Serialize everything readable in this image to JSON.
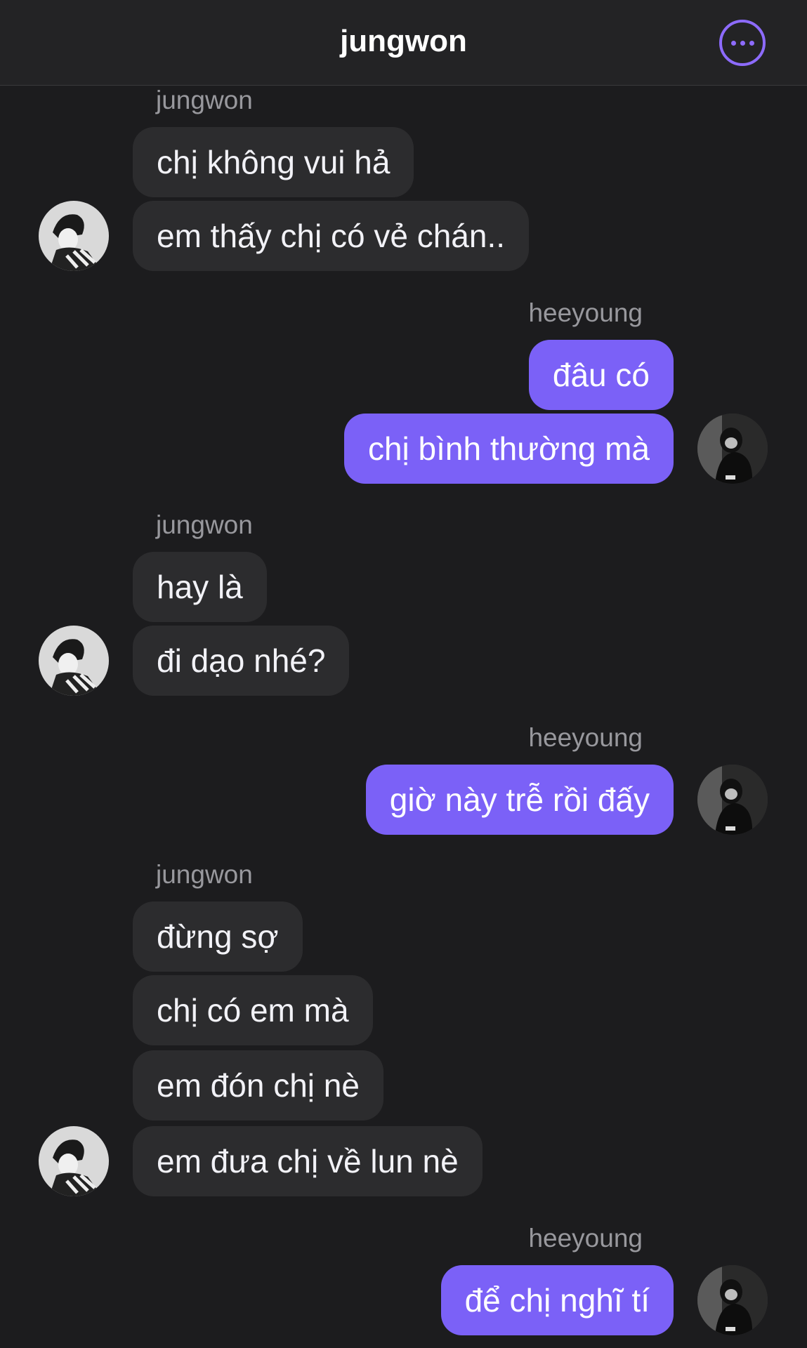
{
  "header": {
    "title": "jungwon",
    "more_icon": "ellipsis-circle-icon",
    "accent": "#8d6bff"
  },
  "colors": {
    "background": "#1c1c1e",
    "incoming_bubble": "#2c2c2e",
    "outgoing_bubble": "#7b61f7"
  },
  "groups": [
    {
      "side": "in",
      "sender": "jungwon",
      "messages": [
        "chị không vui hả",
        "em thấy chị có vẻ chán.."
      ]
    },
    {
      "side": "out",
      "sender": "heeyoung",
      "messages": [
        "đâu có",
        "chị bình thường mà"
      ]
    },
    {
      "side": "in",
      "sender": "jungwon",
      "messages": [
        "hay là",
        "đi dạo nhé?"
      ]
    },
    {
      "side": "out",
      "sender": "heeyoung",
      "messages": [
        "giờ này trễ rồi đấy"
      ]
    },
    {
      "side": "in",
      "sender": "jungwon",
      "messages": [
        "đừng sợ",
        "chị có em mà",
        "em đón chị nè",
        "em đưa chị về lun nè"
      ]
    },
    {
      "side": "out",
      "sender": "heeyoung",
      "messages": [
        "để chị nghĩ tí"
      ]
    }
  ]
}
